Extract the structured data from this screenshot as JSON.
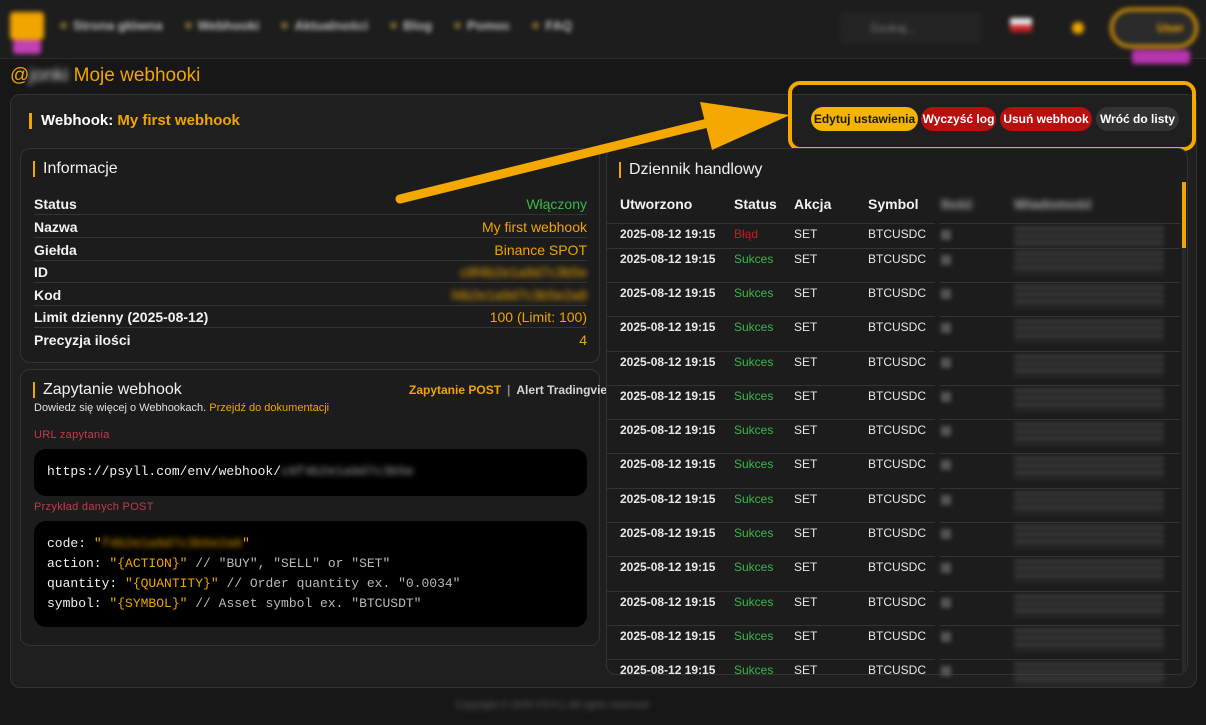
{
  "nav": {
    "items": [
      "Strona główna",
      "Webhooki",
      "Aktualności",
      "Blog",
      "Pomoc",
      "FAQ"
    ],
    "search_placeholder": "Szukaj...",
    "user_label": "User"
  },
  "page": {
    "user_handle": "@",
    "user_name": "jonki",
    "title": "Moje webhooki"
  },
  "webhook": {
    "label": "Webhook:",
    "name": "My first webhook"
  },
  "actions": {
    "edit": "Edytuj ustawienia",
    "clear_log": "Wyczyść log",
    "delete": "Usuń webhook",
    "back": "Wróć do listy"
  },
  "info": {
    "title": "Informacje",
    "rows": [
      {
        "key": "Status",
        "value": "Włączony"
      },
      {
        "key": "Nazwa",
        "value": "My first webhook"
      },
      {
        "key": "Giełda",
        "value": "Binance SPOT"
      },
      {
        "key": "ID",
        "value": "c8f4b2e1a9d7c3b5e"
      },
      {
        "key": "Kod",
        "value": "f4b2e1a9d7c3b5e2a8"
      },
      {
        "key": "Limit dzienny (2025-08-12)",
        "value": "100 (Limit: 100)"
      },
      {
        "key": "Precyzja ilości",
        "value": "4"
      }
    ]
  },
  "request": {
    "title": "Zapytanie webhook",
    "link_post": "Zapytanie POST",
    "separator": "|",
    "link_tv": "Alert Tradingview",
    "subtitle": "Dowiedz się więcej o Webhookach.",
    "doc_link": "Przejdź do dokumentacji",
    "url_label": "URL zapytania",
    "url": "https://psyll.com/env/webhook/",
    "url_token": "c8f4b2e1a9d7c3b5e",
    "post_label": "Przykład danych POST",
    "code": {
      "code_key": "code: ",
      "code_value": "f4b2e1a9d7c3b5e2a8",
      "action_key": "action: ",
      "action_value": "\"{ACTION}\"",
      "action_comment": " // \"BUY\", \"SELL\" or \"SET\"",
      "quantity_key": "quantity: ",
      "quantity_value": "\"{QUANTITY}\"",
      "quantity_comment": " // Order quantity ex. \"0.0034\"",
      "symbol_key": "symbol: ",
      "symbol_value": "\"{SYMBOL}\"",
      "symbol_comment": " // Asset symbol ex. \"BTCUSDT\""
    }
  },
  "log": {
    "title": "Dziennik handlowy",
    "headers": [
      "Utworzono",
      "Status",
      "Akcja",
      "Symbol",
      "Ilość",
      "Wiadomość"
    ],
    "rows": [
      {
        "date": "2025-08-12 19:15",
        "status": "Błąd",
        "ok": false,
        "action": "SET",
        "symbol": "BTCUSDC"
      },
      {
        "date": "2025-08-12 19:15",
        "status": "Sukces",
        "ok": true,
        "action": "SET",
        "symbol": "BTCUSDC"
      },
      {
        "date": "2025-08-12 19:15",
        "status": "Sukces",
        "ok": true,
        "action": "SET",
        "symbol": "BTCUSDC"
      },
      {
        "date": "2025-08-12 19:15",
        "status": "Sukces",
        "ok": true,
        "action": "SET",
        "symbol": "BTCUSDC"
      },
      {
        "date": "2025-08-12 19:15",
        "status": "Sukces",
        "ok": true,
        "action": "SET",
        "symbol": "BTCUSDC"
      },
      {
        "date": "2025-08-12 19:15",
        "status": "Sukces",
        "ok": true,
        "action": "SET",
        "symbol": "BTCUSDC"
      },
      {
        "date": "2025-08-12 19:15",
        "status": "Sukces",
        "ok": true,
        "action": "SET",
        "symbol": "BTCUSDC"
      },
      {
        "date": "2025-08-12 19:15",
        "status": "Sukces",
        "ok": true,
        "action": "SET",
        "symbol": "BTCUSDC"
      },
      {
        "date": "2025-08-12 19:15",
        "status": "Sukces",
        "ok": true,
        "action": "SET",
        "symbol": "BTCUSDC"
      },
      {
        "date": "2025-08-12 19:15",
        "status": "Sukces",
        "ok": true,
        "action": "SET",
        "symbol": "BTCUSDC"
      },
      {
        "date": "2025-08-12 19:15",
        "status": "Sukces",
        "ok": true,
        "action": "SET",
        "symbol": "BTCUSDC"
      },
      {
        "date": "2025-08-12 19:15",
        "status": "Sukces",
        "ok": true,
        "action": "SET",
        "symbol": "BTCUSDC"
      },
      {
        "date": "2025-08-12 19:15",
        "status": "Sukces",
        "ok": true,
        "action": "SET",
        "symbol": "BTCUSDC"
      },
      {
        "date": "2025-08-12 19:15",
        "status": "Sukces",
        "ok": true,
        "action": "SET",
        "symbol": "BTCUSDC"
      }
    ]
  },
  "footer": {
    "text": "Copyright © 2025 PSYLL All rights reserved"
  },
  "colors": {
    "accent": "#f0a500",
    "success": "#3cb64a",
    "danger": "#b80f0f",
    "background": "#171717"
  }
}
